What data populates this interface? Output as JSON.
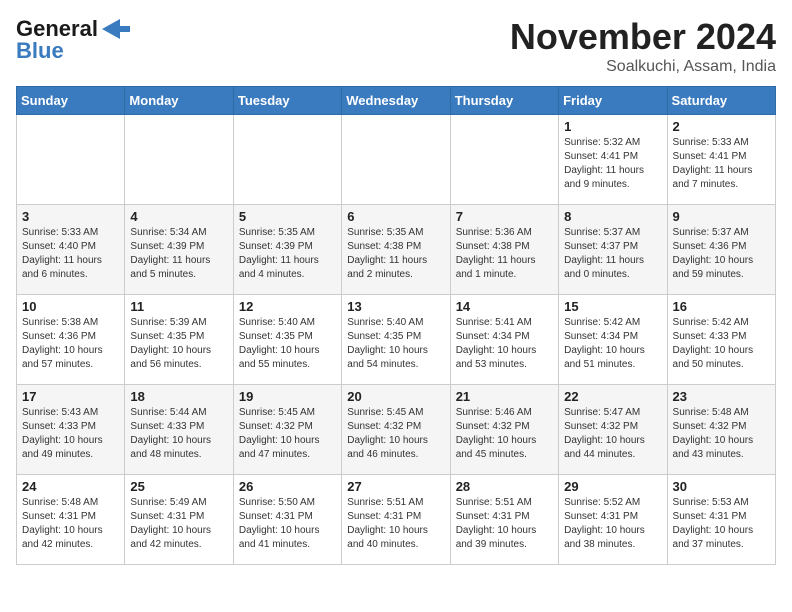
{
  "header": {
    "logo_line1": "General",
    "logo_line2": "Blue",
    "month_title": "November 2024",
    "subtitle": "Soalkuchi, Assam, India"
  },
  "weekdays": [
    "Sunday",
    "Monday",
    "Tuesday",
    "Wednesday",
    "Thursday",
    "Friday",
    "Saturday"
  ],
  "weeks": [
    [
      {
        "day": "",
        "info": ""
      },
      {
        "day": "",
        "info": ""
      },
      {
        "day": "",
        "info": ""
      },
      {
        "day": "",
        "info": ""
      },
      {
        "day": "",
        "info": ""
      },
      {
        "day": "1",
        "info": "Sunrise: 5:32 AM\nSunset: 4:41 PM\nDaylight: 11 hours\nand 9 minutes."
      },
      {
        "day": "2",
        "info": "Sunrise: 5:33 AM\nSunset: 4:41 PM\nDaylight: 11 hours\nand 7 minutes."
      }
    ],
    [
      {
        "day": "3",
        "info": "Sunrise: 5:33 AM\nSunset: 4:40 PM\nDaylight: 11 hours\nand 6 minutes."
      },
      {
        "day": "4",
        "info": "Sunrise: 5:34 AM\nSunset: 4:39 PM\nDaylight: 11 hours\nand 5 minutes."
      },
      {
        "day": "5",
        "info": "Sunrise: 5:35 AM\nSunset: 4:39 PM\nDaylight: 11 hours\nand 4 minutes."
      },
      {
        "day": "6",
        "info": "Sunrise: 5:35 AM\nSunset: 4:38 PM\nDaylight: 11 hours\nand 2 minutes."
      },
      {
        "day": "7",
        "info": "Sunrise: 5:36 AM\nSunset: 4:38 PM\nDaylight: 11 hours\nand 1 minute."
      },
      {
        "day": "8",
        "info": "Sunrise: 5:37 AM\nSunset: 4:37 PM\nDaylight: 11 hours\nand 0 minutes."
      },
      {
        "day": "9",
        "info": "Sunrise: 5:37 AM\nSunset: 4:36 PM\nDaylight: 10 hours\nand 59 minutes."
      }
    ],
    [
      {
        "day": "10",
        "info": "Sunrise: 5:38 AM\nSunset: 4:36 PM\nDaylight: 10 hours\nand 57 minutes."
      },
      {
        "day": "11",
        "info": "Sunrise: 5:39 AM\nSunset: 4:35 PM\nDaylight: 10 hours\nand 56 minutes."
      },
      {
        "day": "12",
        "info": "Sunrise: 5:40 AM\nSunset: 4:35 PM\nDaylight: 10 hours\nand 55 minutes."
      },
      {
        "day": "13",
        "info": "Sunrise: 5:40 AM\nSunset: 4:35 PM\nDaylight: 10 hours\nand 54 minutes."
      },
      {
        "day": "14",
        "info": "Sunrise: 5:41 AM\nSunset: 4:34 PM\nDaylight: 10 hours\nand 53 minutes."
      },
      {
        "day": "15",
        "info": "Sunrise: 5:42 AM\nSunset: 4:34 PM\nDaylight: 10 hours\nand 51 minutes."
      },
      {
        "day": "16",
        "info": "Sunrise: 5:42 AM\nSunset: 4:33 PM\nDaylight: 10 hours\nand 50 minutes."
      }
    ],
    [
      {
        "day": "17",
        "info": "Sunrise: 5:43 AM\nSunset: 4:33 PM\nDaylight: 10 hours\nand 49 minutes."
      },
      {
        "day": "18",
        "info": "Sunrise: 5:44 AM\nSunset: 4:33 PM\nDaylight: 10 hours\nand 48 minutes."
      },
      {
        "day": "19",
        "info": "Sunrise: 5:45 AM\nSunset: 4:32 PM\nDaylight: 10 hours\nand 47 minutes."
      },
      {
        "day": "20",
        "info": "Sunrise: 5:45 AM\nSunset: 4:32 PM\nDaylight: 10 hours\nand 46 minutes."
      },
      {
        "day": "21",
        "info": "Sunrise: 5:46 AM\nSunset: 4:32 PM\nDaylight: 10 hours\nand 45 minutes."
      },
      {
        "day": "22",
        "info": "Sunrise: 5:47 AM\nSunset: 4:32 PM\nDaylight: 10 hours\nand 44 minutes."
      },
      {
        "day": "23",
        "info": "Sunrise: 5:48 AM\nSunset: 4:32 PM\nDaylight: 10 hours\nand 43 minutes."
      }
    ],
    [
      {
        "day": "24",
        "info": "Sunrise: 5:48 AM\nSunset: 4:31 PM\nDaylight: 10 hours\nand 42 minutes."
      },
      {
        "day": "25",
        "info": "Sunrise: 5:49 AM\nSunset: 4:31 PM\nDaylight: 10 hours\nand 42 minutes."
      },
      {
        "day": "26",
        "info": "Sunrise: 5:50 AM\nSunset: 4:31 PM\nDaylight: 10 hours\nand 41 minutes."
      },
      {
        "day": "27",
        "info": "Sunrise: 5:51 AM\nSunset: 4:31 PM\nDaylight: 10 hours\nand 40 minutes."
      },
      {
        "day": "28",
        "info": "Sunrise: 5:51 AM\nSunset: 4:31 PM\nDaylight: 10 hours\nand 39 minutes."
      },
      {
        "day": "29",
        "info": "Sunrise: 5:52 AM\nSunset: 4:31 PM\nDaylight: 10 hours\nand 38 minutes."
      },
      {
        "day": "30",
        "info": "Sunrise: 5:53 AM\nSunset: 4:31 PM\nDaylight: 10 hours\nand 37 minutes."
      }
    ]
  ]
}
